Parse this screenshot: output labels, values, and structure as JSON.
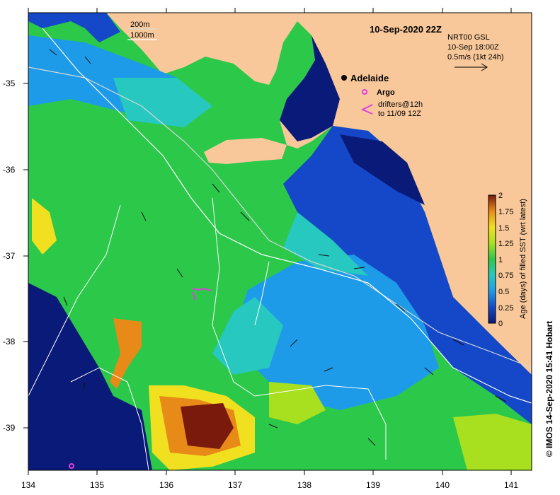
{
  "title": "10-Sep-2020 22Z",
  "place": {
    "name": "Adelaide"
  },
  "legend": {
    "isobath_200": "200m",
    "isobath_1000": "1000m",
    "argo_label": "Argo",
    "drifters_line1": "drifters@12h",
    "drifters_line2": "to 11/09 12Z"
  },
  "current_info": {
    "line1": "NRT00 GSL",
    "line2": "10-Sep 18:00Z",
    "line3": "0.5m/s (1kt 24h)"
  },
  "colorbar": {
    "label": "Age (days) of filled SST (wrt latest)",
    "ticks": [
      "0",
      "0.25",
      "0.5",
      "0.75",
      "1",
      "1.25",
      "1.5",
      "1.75",
      "2"
    ]
  },
  "axes": {
    "x_ticks": [
      "134",
      "135",
      "136",
      "137",
      "138",
      "139",
      "140",
      "141"
    ],
    "y_ticks": [
      "-35",
      "-36",
      "-37",
      "-38",
      "-39"
    ]
  },
  "credit": "© IMOS 14-Sep-2020 15:41 Hobart",
  "colors": {
    "land": "#f9c89a",
    "age_0": "#0a1a78",
    "age_025": "#1448c8",
    "age_05": "#1e9be8",
    "age_075": "#26c8c0",
    "age_1": "#2cc84a",
    "age_125": "#a8e020",
    "age_15": "#f0e020",
    "age_175": "#e88a18",
    "age_2": "#7a1a0c",
    "argo": "#e040e0"
  }
}
